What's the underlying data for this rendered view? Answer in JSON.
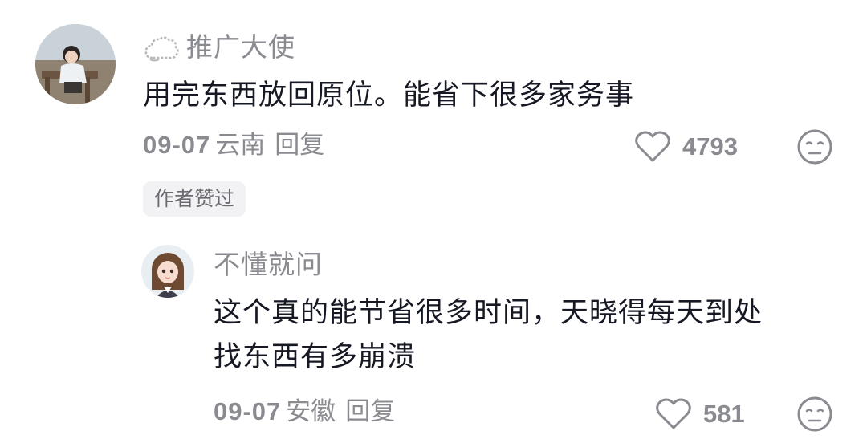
{
  "comments": [
    {
      "username": "推广大使",
      "avatar_icon": "girl-on-bench-avatar",
      "text_lines": [
        "用完东西放回原位。能省下很多家务事"
      ],
      "date": "09-07",
      "location": "云南",
      "reply_label": "回复",
      "likes": "4793",
      "badge": "作者赞过"
    },
    {
      "username": "不懂就问",
      "avatar_icon": "cartoon-girl-avatar",
      "text_lines": [
        "这个真的能节省很多时间，天晓得每天到处",
        "找东西有多崩溃"
      ],
      "date": "09-07",
      "location": "安徽",
      "reply_label": "回复",
      "likes": "581"
    }
  ],
  "icons": {
    "username_prefix": "cloud-icon",
    "like": "heart-icon",
    "dislike": "meh-face-icon"
  },
  "colors": {
    "text": "#161823",
    "secondary": "#8a8b91",
    "badge_bg": "#f2f2f4"
  }
}
